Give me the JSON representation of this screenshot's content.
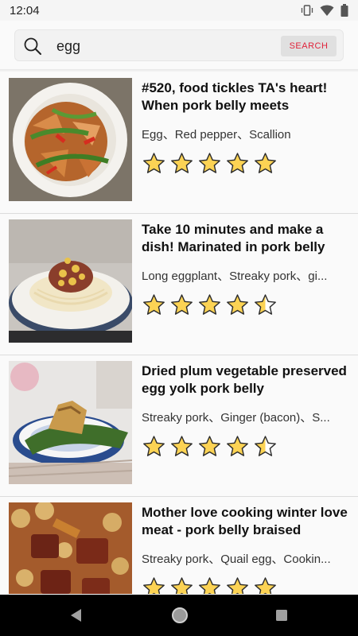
{
  "status_bar": {
    "time": "12:04",
    "icons": [
      "vibrate-icon",
      "wifi-icon",
      "battery-icon"
    ]
  },
  "search": {
    "query": "egg",
    "button_label": "SEARCH",
    "button_color": "#e0233b"
  },
  "recipes": [
    {
      "title": "#520, food tickles TA's heart! When pork belly meets",
      "ingredients": "Egg、Red pepper、Scallion",
      "rating": 5
    },
    {
      "title": "Take 10 minutes and make a dish! Marinated in pork belly",
      "ingredients": "Long eggplant、Streaky pork、gi...",
      "rating": 4.5
    },
    {
      "title": "Dried plum vegetable preserved egg yolk pork belly",
      "ingredients": "Streaky pork、Ginger (bacon)、S...",
      "rating": 4.5
    },
    {
      "title": "Mother love cooking winter love meat - pork belly braised",
      "ingredients": "Streaky pork、Quail egg、Cookin...",
      "rating": 5
    }
  ],
  "colors": {
    "star_fill": "#fcd354",
    "star_stroke": "#2b2b2b"
  },
  "nav": {
    "icons": [
      "back-icon",
      "home-icon",
      "recent-apps-icon"
    ]
  }
}
